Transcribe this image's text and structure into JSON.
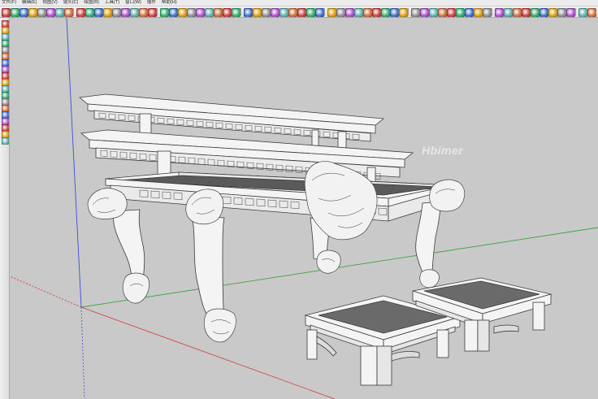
{
  "menubar": {
    "items": [
      "文件(F)",
      "编辑(E)",
      "视图(V)",
      "镜头(C)",
      "绘图(R)",
      "工具(T)",
      "窗口(W)",
      "插件",
      "帮助(H)"
    ]
  },
  "toolbar": {
    "icons": [
      "select-icon",
      "eraser-icon",
      "paint-bucket-icon",
      "line-icon",
      "arc-icon",
      "rectangle-icon",
      "push-pull-icon",
      "move-icon",
      "rotate-icon",
      "offset-icon",
      "tape-measure-icon",
      "text-icon",
      "orbit-icon",
      "pan-icon",
      "zoom-icon",
      "zoom-extents-icon"
    ]
  },
  "left_toolbar": {
    "icons": [
      "select-icon",
      "eraser-icon",
      "pencil-icon",
      "arc-icon",
      "rectangle-icon",
      "circle-icon",
      "polygon-icon",
      "push-pull-icon",
      "follow-me-icon",
      "move-icon",
      "rotate-icon",
      "scale-icon",
      "offset-icon",
      "tape-measure-icon",
      "dimension-icon",
      "orbit-icon",
      "walk-icon",
      "look-around-icon",
      "section-plane-icon"
    ]
  },
  "watermark": {
    "text": "Hbimer"
  },
  "colors": {
    "background": "#c9c9c9",
    "axis_red": "#d63c3c",
    "axis_green": "#3fa043",
    "axis_blue": "#3c4fd6",
    "model_face": "#f4f4f4",
    "model_edge": "#3a3a3a",
    "stool_top": "#6a6a6a"
  }
}
